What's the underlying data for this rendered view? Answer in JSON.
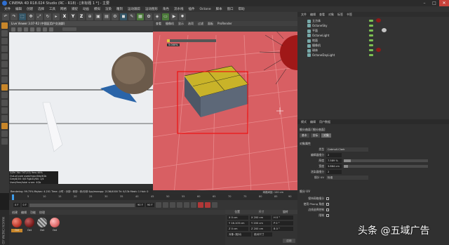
{
  "titlebar": {
    "title": "CINEMA 4D R18.024 Studio (RC - R18) - [未标题 1 *] - 主要",
    "minimize": "–",
    "maximize": "□",
    "close": "✕"
  },
  "menubar": {
    "items": [
      "文件",
      "编辑",
      "创建",
      "选择",
      "工具",
      "网格",
      "捕捉",
      "动画",
      "模拟",
      "渲染",
      "雕刻",
      "运动跟踪",
      "运动图形",
      "角色",
      "流水线",
      "插件",
      "Octane",
      "脚本",
      "窗口",
      "帮助"
    ]
  },
  "toolbar": {
    "axis_x": "X",
    "axis_y": "Y",
    "axis_z": "Z"
  },
  "viewport1": {
    "header": "Live Viewer 3.07-R2 (中国区用户交流群)",
    "status_line": "Check:Strg,Geo, MeshGen:0ms, Update[C]:0ms, Mesh 1 Nodes 19 Movable 12   0 0",
    "info": [
      "GZM 784 TXT(13)           9ms      46%",
      "Out-of-core used/max:0kb/4Gb",
      "Grey8/16: 0/0            Rgb32/64: 1/4",
      "Used/free/total vram: 4Gb"
    ],
    "footer": "Rendering: 99.75%   Ms/sec: 4.201   Time: 小时 : 分钟 : 秒钟 : 秒/分钟   Spp/maxspp: 2136/4000   Tri: 0/13k   Mesh: 1   Hair: 0"
  },
  "viewport2": {
    "tabs": [
      "查看",
      "摄像机",
      "显示",
      "选项",
      "过滤",
      "面板",
      "ProRender"
    ],
    "footer": "网格间距: 100 cm",
    "box_label": "5.000%"
  },
  "timeline": {
    "ticks": [
      "0",
      "5",
      "10",
      "15",
      "20",
      "25",
      "30",
      "35",
      "40",
      "45",
      "50",
      "55",
      "60",
      "65",
      "70",
      "75",
      "80",
      "85",
      "90"
    ],
    "current_frame": "0 F",
    "start_frame": "0 F",
    "end_frame": "90 F",
    "max_frame": "90 F",
    "frame_indicator": "0 F"
  },
  "material_manager": {
    "menu": [
      "创建",
      "编辑",
      "功能",
      "纹理"
    ],
    "materials": [
      {
        "label": "Oct",
        "color": "#c0392b"
      },
      {
        "label": "Oct",
        "color": "#7a1e1e"
      },
      {
        "label": "Oct",
        "color": "#9b9b9b"
      },
      {
        "label": "Oct",
        "color": "#e06a6a"
      }
    ],
    "side_label": "MAXON CINEMA 4D"
  },
  "coordinates": {
    "headers": [
      "位置",
      "尺寸",
      "旋转"
    ],
    "rows": [
      {
        "pos": "X 0 cm",
        "size": "X 200 cm",
        "rot": "H 0 °"
      },
      {
        "pos": "Y 16.103 cm",
        "size": "Y 200 cm",
        "rot": "P 0 °"
      },
      {
        "pos": "Z 0 cm",
        "size": "Z 200 cm",
        "rot": "B 0 °"
      }
    ],
    "mode": "对象 (相对)",
    "size_mode": "绝对尺寸",
    "apply": "应用"
  },
  "object_manager": {
    "tabs": [
      "文件",
      "编辑",
      "查看",
      "对象",
      "标签",
      "书签"
    ],
    "objects": [
      "立方体",
      "OctaneSky",
      "平面",
      "OctaneLight",
      "地面",
      "摄像机",
      "球体",
      "OctaneDayLight"
    ],
    "nav_button": "返回上层"
  },
  "attribute_manager": {
    "tabs": [
      "模式",
      "编辑",
      "用户数据"
    ],
    "object_title": "细分曲面 [细分曲面]",
    "subtabs": [
      "基本",
      "坐标",
      "对象"
    ],
    "section_object": "对象属性",
    "props": [
      {
        "label": "类型",
        "value": "Catmull-Clark"
      },
      {
        "label": "编辑器细分",
        "value": "2"
      },
      {
        "label": "渲染器细分",
        "value": "2"
      },
      {
        "label": "细分 UV",
        "value": "标准"
      }
    ],
    "sliders": [
      {
        "label": "厚度",
        "value": "7.589 %",
        "fill": 0.08
      },
      {
        "label": "宽度",
        "value": "3.864 cm",
        "fill": 0.05
      }
    ],
    "section_other": "细分 UV",
    "checks": [
      "保持网格细分",
      "使用 Phong 角度",
      "边线选择控制",
      "限制"
    ]
  },
  "watermark": "头条 @五域广告"
}
